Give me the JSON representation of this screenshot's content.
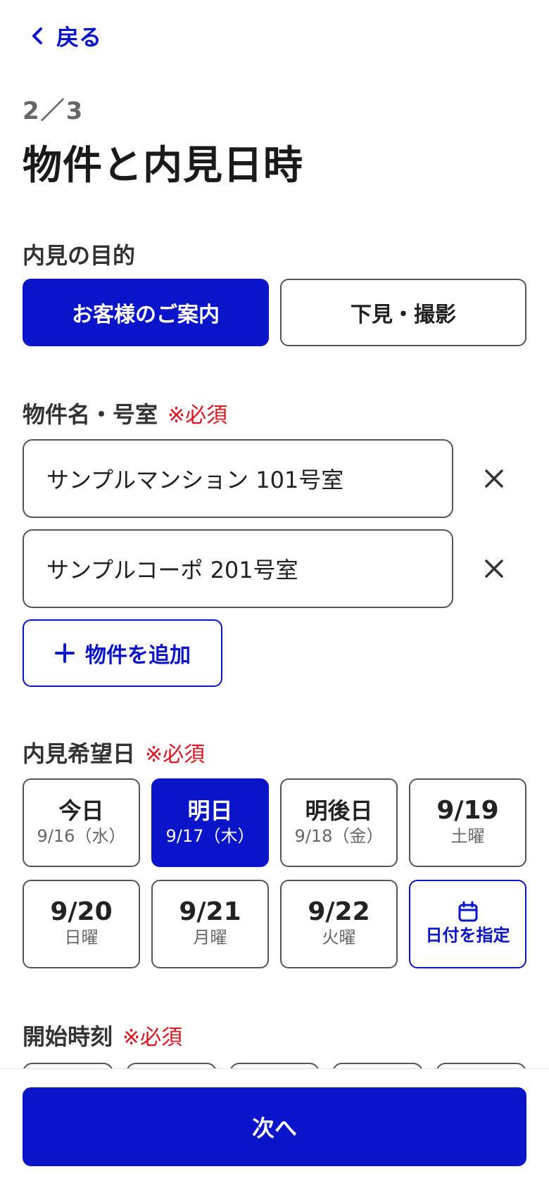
{
  "nav": {
    "back_label": "戻る"
  },
  "header": {
    "step": "2／3",
    "title": "物件と内見日時"
  },
  "purpose": {
    "label": "内見の目的",
    "options": [
      "お客様のご案内",
      "下見・撮影"
    ],
    "selected": "お客様のご案内"
  },
  "property": {
    "label": "物件名・号室",
    "required": "※必須",
    "fields": [
      "サンプルマンション 101号室",
      "サンプルコーポ 201号室"
    ],
    "add_label": "物件を追加"
  },
  "date": {
    "label": "内見希望日",
    "required": "※必須",
    "options": [
      {
        "main": "今日",
        "sub": "9/16（水）"
      },
      {
        "main": "明日",
        "sub": "9/17（木）"
      },
      {
        "main": "明後日",
        "sub": "9/18（金）"
      },
      {
        "main": "9/19",
        "sub": "土曜"
      },
      {
        "main": "9/20",
        "sub": "日曜"
      },
      {
        "main": "9/21",
        "sub": "月曜"
      },
      {
        "main": "9/22",
        "sub": "火曜"
      }
    ],
    "selected": "明日",
    "pick_label": "日付を指定"
  },
  "time": {
    "label": "開始時刻",
    "required": "※必須"
  },
  "footer": {
    "next_label": "次へ"
  },
  "colors": {
    "accent": "#0a14c8",
    "required": "#e0141e",
    "border": "#555555"
  }
}
